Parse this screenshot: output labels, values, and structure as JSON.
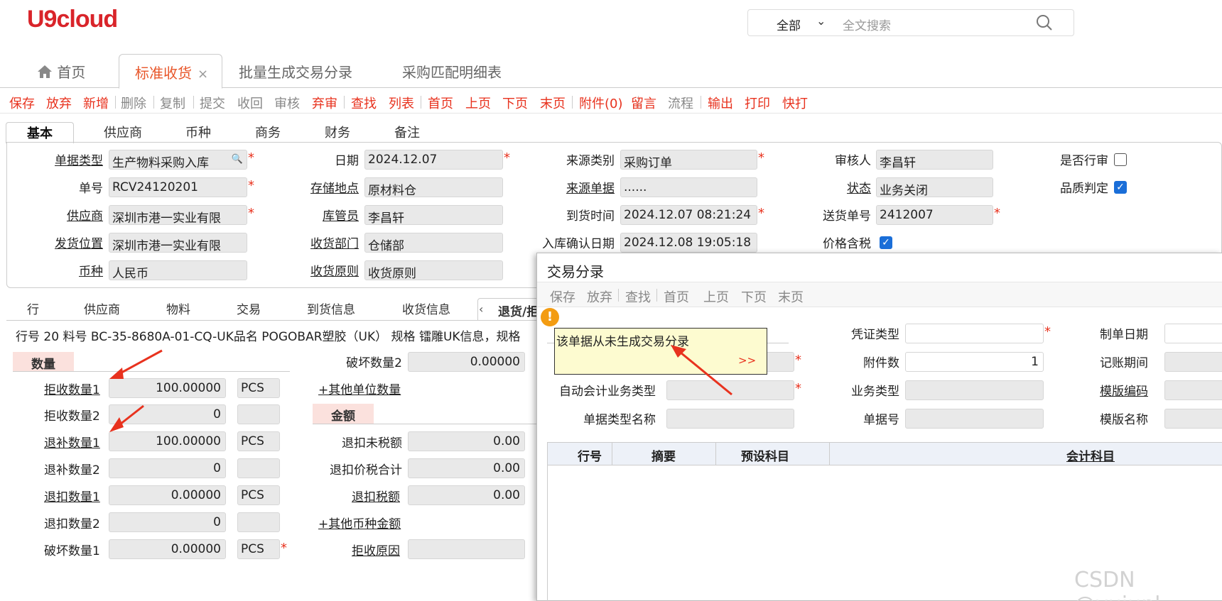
{
  "app": {
    "logo": "U9cloud"
  },
  "search": {
    "scope": "全部",
    "placeholder": "全文搜索"
  },
  "tabs": [
    {
      "label": "首页"
    },
    {
      "label": "标准收货",
      "close": "×"
    },
    {
      "label": "批量生成交易分录"
    },
    {
      "label": "采购匹配明细表"
    }
  ],
  "toolbar": [
    "保存",
    "放弃",
    "新增",
    "删除",
    "复制",
    "提交",
    "收回",
    "审核",
    "弃审",
    "查找",
    "列表",
    "首页",
    "上页",
    "下页",
    "末页",
    "附件(0)",
    "留言",
    "流程",
    "输出",
    "打印",
    "快打"
  ],
  "subtabs": [
    "基本",
    "供应商",
    "币种",
    "商务",
    "财务",
    "备注"
  ],
  "header": {
    "doc_type_label": "单据类型",
    "doc_type": "生产物料采购入库",
    "doc_no_label": "单号",
    "doc_no": "RCV24120201",
    "supplier_label": "供应商",
    "supplier": "深圳市港一实业有限",
    "ship_loc_label": "发货位置",
    "ship_loc": "深圳市港一实业有限",
    "currency_label": "币种",
    "currency": "人民币",
    "date_label": "日期",
    "date": "2024.12.07",
    "storage_label": "存储地点",
    "storage": "原材料仓",
    "keeper_label": "库管员",
    "keeper": "李昌轩",
    "dept_label": "收货部门",
    "dept": "仓储部",
    "principle_label": "收货原则",
    "principle": "收货原则",
    "src_type_label": "来源类别",
    "src_type": "采购订单",
    "src_doc_label": "来源单据",
    "src_doc": "......",
    "arrival_label": "到货时间",
    "arrival": "2024.12.07 08:21:24",
    "confirm_label": "入库确认日期",
    "confirm": "2024.12.08 19:05:18",
    "reviewer_label": "审核人",
    "reviewer": "李昌轩",
    "status_label": "状态",
    "status": "业务关闭",
    "delivery_label": "送货单号",
    "delivery": "2412007",
    "tax_label": "价格含税",
    "row_review_label": "是否行审",
    "quality_label": "品质判定"
  },
  "line_tabs": [
    "行",
    "供应商",
    "物料",
    "交易",
    "到货信息",
    "收货信息",
    "退货/拒"
  ],
  "line_info": "行号 20 料号 BC-35-8680A-01-CQ-UK品名 POGOBAR塑胶（UK） 规格 镭雕UK信息，规格",
  "qty": {
    "section": "数量",
    "reject1_label": "拒收数量1",
    "reject1": "100.00000",
    "reject1_unit": "PCS",
    "reject2_label": "拒收数量2",
    "reject2": "0",
    "refill1_label": "退补数量1",
    "refill1": "100.00000",
    "refill1_unit": "PCS",
    "refill2_label": "退补数量2",
    "refill2": "0",
    "deduct1_label": "退扣数量1",
    "deduct1": "0.00000",
    "deduct1_unit": "PCS",
    "deduct2_label": "退扣数量2",
    "deduct2": "0",
    "damage1_label": "破坏数量1",
    "damage1": "0.00000",
    "damage1_unit": "PCS",
    "damage2_label": "破坏数量2",
    "damage2": "0.00000",
    "other_units": "+其他单位数量"
  },
  "amount": {
    "section": "金额",
    "net_label": "退扣未税额",
    "net": "0.00",
    "total_label": "退扣价税合计",
    "total": "0.00",
    "tax_label": "退扣税额",
    "tax": "0.00",
    "other_currency": "+其他币种金额",
    "reason_label": "拒收原因"
  },
  "dialog": {
    "title": "交易分录",
    "toolbar": [
      "保存",
      "放弃",
      "查找",
      "首页",
      "上页",
      "下页",
      "末页"
    ],
    "voucher_type_label": "凭证类型",
    "attach_label": "附件数",
    "attach": "1",
    "biz_type_label": "业务类型",
    "auto_acct_label": "自动会计业务类型",
    "doc_type_name_label": "单据类型名称",
    "doc_no_label": "单据号",
    "make_date_label": "制单日期",
    "period_label": "记账期间",
    "template_code_label": "模版编码",
    "template_name_label": "模版名称",
    "grid_headers": [
      "行号",
      "摘要",
      "预设科目",
      "会计科目"
    ]
  },
  "tooltip": {
    "message": "该单据从未生成交易分录",
    "more": ">>"
  },
  "watermark": "CSDN @yujunl"
}
